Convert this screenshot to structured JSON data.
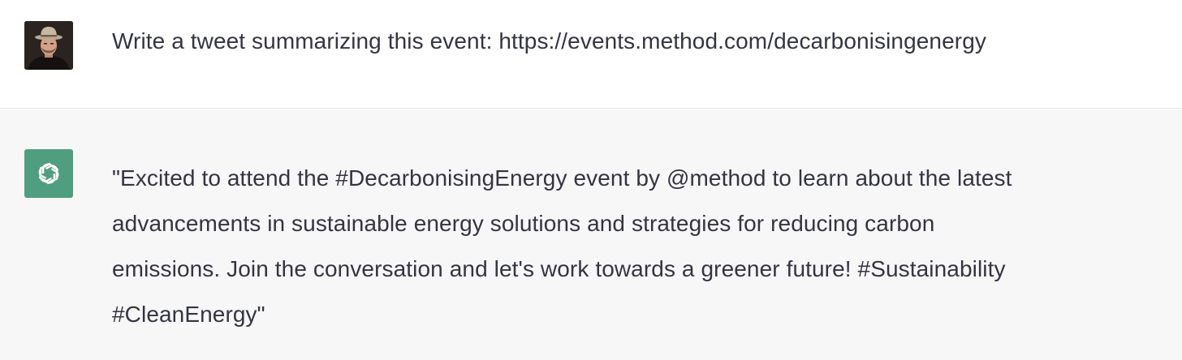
{
  "thread": {
    "user_message": {
      "avatar_icon": "user-photo-avatar",
      "text": "Write a tweet summarizing this event: https://events.method.com/decarbonisingenergy"
    },
    "assistant_message": {
      "avatar_icon": "openai-logo-icon",
      "avatar_color": "#4f9e80",
      "lines": [
        "\"Excited to attend the #DecarbonisingEnergy event by @method to learn about the latest",
        "advancements in sustainable energy solutions and strategies for reducing carbon",
        "emissions. Join the conversation and let's work towards a greener future! #Sustainability",
        "#CleanEnergy\""
      ]
    }
  },
  "colors": {
    "text": "#343541",
    "assistant_bg": "#f7f7f8",
    "user_bg": "#ffffff",
    "divider": "#e5e5e6"
  }
}
